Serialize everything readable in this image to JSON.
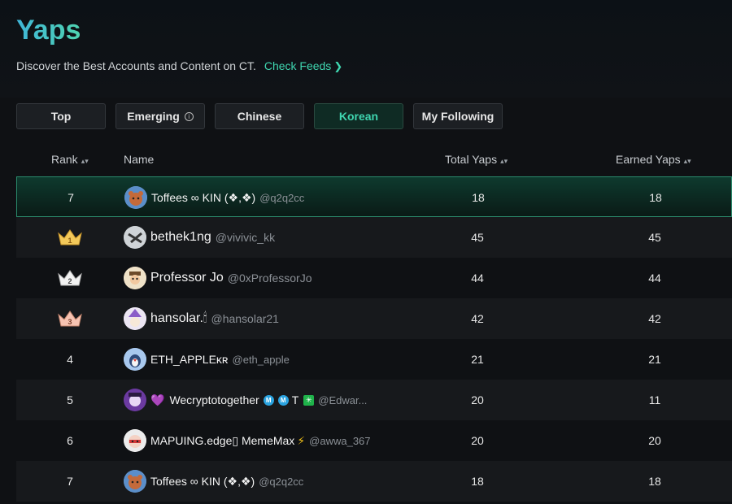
{
  "header": {
    "title": "Yaps",
    "subtitle": "Discover the Best Accounts and Content on CT.",
    "check_feeds": "Check Feeds"
  },
  "tabs": [
    {
      "label": "Top",
      "active": false
    },
    {
      "label": "Emerging",
      "active": false,
      "info_icon": "info-icon"
    },
    {
      "label": "Chinese",
      "active": false
    },
    {
      "label": "Korean",
      "active": true
    },
    {
      "label": "My Following",
      "active": false
    }
  ],
  "table": {
    "columns": {
      "rank": "Rank",
      "name": "Name",
      "total": "Total Yaps",
      "earned": "Earned Yaps"
    },
    "rows": [
      {
        "rank": "7",
        "name": "Toffees ∞ KIN (❖,❖)",
        "handle": "@q2q2cc",
        "total": "18",
        "earned": "18",
        "highlight": true
      },
      {
        "rank": "1",
        "crown": "gold",
        "name": "bethek1ng",
        "handle": "@vivivic_kk",
        "total": "45",
        "earned": "45"
      },
      {
        "rank": "2",
        "crown": "silver",
        "name": "Professor Jo",
        "handle": "@0xProfessorJo",
        "total": "44",
        "earned": "44"
      },
      {
        "rank": "3",
        "crown": "bronze",
        "name": "hansolar.🕯",
        "handle": "@hansolar21",
        "total": "42",
        "earned": "42"
      },
      {
        "rank": "4",
        "name": "ETH_APPLEᴋʀ",
        "handle": "@eth_apple",
        "total": "21",
        "earned": "21"
      },
      {
        "rank": "5",
        "name": "Wecryptotogether",
        "name_suffix": "T",
        "handle": "@Edwar...",
        "total": "20",
        "earned": "11"
      },
      {
        "rank": "6",
        "name": "MAPUING.edge▯ MemeMax",
        "handle": "@awwa_367",
        "total": "20",
        "earned": "20"
      },
      {
        "rank": "7",
        "name": "Toffees ∞ KIN (❖,❖)",
        "handle": "@q2q2cc",
        "total": "18",
        "earned": "18"
      }
    ]
  },
  "colors": {
    "accent": "#3fd6b0",
    "gold": "#f0c040",
    "silver": "#e8e8e8",
    "bronze": "#f0b0a0"
  }
}
